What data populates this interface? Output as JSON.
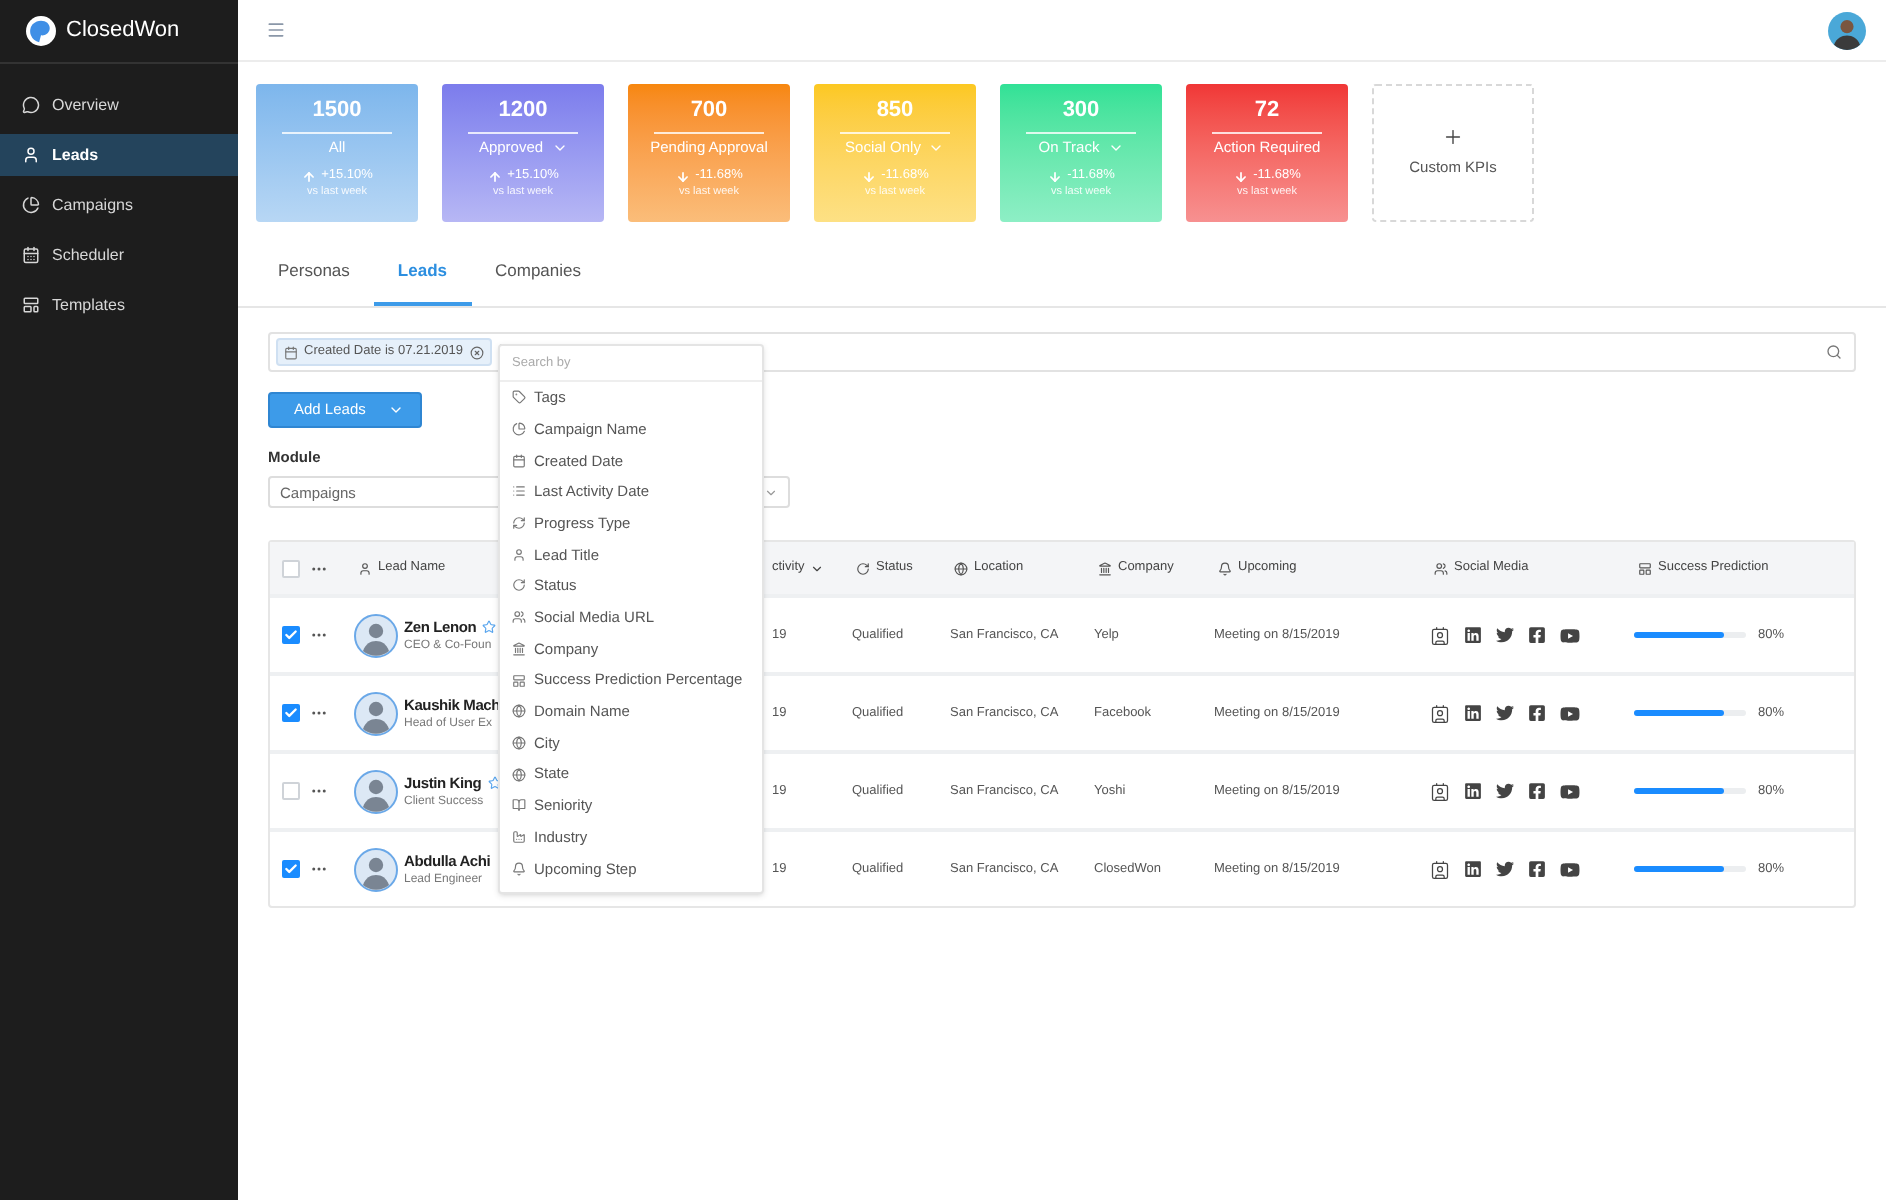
{
  "brand": {
    "name": "ClosedWon"
  },
  "sidebar": {
    "items": [
      {
        "label": "Overview",
        "selected": false
      },
      {
        "label": "Leads",
        "selected": true
      },
      {
        "label": "Campaigns",
        "selected": false
      },
      {
        "label": "Scheduler",
        "selected": false
      },
      {
        "label": "Templates",
        "selected": false
      }
    ]
  },
  "kpis": [
    {
      "value": "1500",
      "label": "All",
      "dropdown": false,
      "rising": true,
      "change": "+15.10%",
      "period": "vs last week",
      "color": "#7db6ec"
    },
    {
      "value": "1200",
      "label": "Approved",
      "dropdown": true,
      "rising": true,
      "change": "+15.10%",
      "period": "vs last week",
      "color": "#7c7cec"
    },
    {
      "value": "700",
      "label": "Pending Approval",
      "dropdown": false,
      "rising": false,
      "change": "-11.68%",
      "period": "vs last week",
      "color": "#f7870c"
    },
    {
      "value": "850",
      "label": "Social Only",
      "dropdown": true,
      "rising": false,
      "change": "-11.68%",
      "period": "vs last week",
      "color": "#fcc820"
    },
    {
      "value": "300",
      "label": "On Track",
      "dropdown": true,
      "rising": false,
      "change": "-11.68%",
      "period": "vs last week",
      "color": "#30e196"
    },
    {
      "value": "72",
      "label": "Action Required",
      "dropdown": false,
      "rising": false,
      "change": "-11.68%",
      "period": "vs last week",
      "color": "#f03636"
    }
  ],
  "custom_kpi": {
    "label": "Custom KPIs"
  },
  "tabs": [
    {
      "label": "Personas",
      "selected": false
    },
    {
      "label": "Leads",
      "selected": true
    },
    {
      "label": "Companies",
      "selected": false
    }
  ],
  "filter": {
    "chip": "Created Date is 07.21.2019"
  },
  "add_button": {
    "label": "Add Leads"
  },
  "module": {
    "label": "Module",
    "value": "Campaigns"
  },
  "dropdown": {
    "header": "Search by",
    "items": [
      "Tags",
      "Campaign Name",
      "Created Date",
      "Last Activity Date",
      "Progress Type",
      "Lead Title",
      "Status",
      "Social Media URL",
      "Company",
      "Success Prediction Percentage",
      "Domain Name",
      "City",
      "State",
      "Seniority",
      "Industry",
      "Upcoming Step"
    ]
  },
  "table": {
    "header_checked": false,
    "columns": [
      {
        "label": "Lead Name",
        "caret": false
      },
      {
        "label": "ctivity",
        "caret": true
      },
      {
        "label": "Status",
        "caret": false
      },
      {
        "label": "Location",
        "caret": false
      },
      {
        "label": "Company",
        "caret": false
      },
      {
        "label": "Upcoming",
        "caret": false
      },
      {
        "label": "Social Media",
        "caret": false
      },
      {
        "label": "Success Prediction",
        "caret": false
      }
    ],
    "rows": [
      {
        "checked": true,
        "name": "Zen Lenon",
        "star": true,
        "title": "CEO & Co-Foun",
        "activity": "19",
        "status": "Qualified",
        "location": "San Francisco, CA",
        "company": "Yelp",
        "upcoming": "Meeting on 8/15/2019",
        "level": 0.8,
        "reading": "80%"
      },
      {
        "checked": true,
        "name": "Kaushik Mach",
        "star": false,
        "title": "Head of User Ex",
        "activity": "19",
        "status": "Qualified",
        "location": "San Francisco, CA",
        "company": "Facebook",
        "upcoming": "Meeting on 8/15/2019",
        "level": 0.8,
        "reading": "80%"
      },
      {
        "checked": false,
        "name": "Justin King",
        "star": true,
        "title": "Client Success",
        "activity": "19",
        "status": "Qualified",
        "location": "San Francisco, CA",
        "company": "Yoshi",
        "upcoming": "Meeting on 8/15/2019",
        "level": 0.8,
        "reading": "80%"
      },
      {
        "checked": true,
        "name": "Abdulla Achi",
        "star": false,
        "title": "Lead Engineer",
        "activity": "19",
        "status": "Qualified",
        "location": "San Francisco, CA",
        "company": "ClosedWon",
        "upcoming": "Meeting on 8/15/2019",
        "level": 0.8,
        "reading": "80%"
      }
    ]
  }
}
